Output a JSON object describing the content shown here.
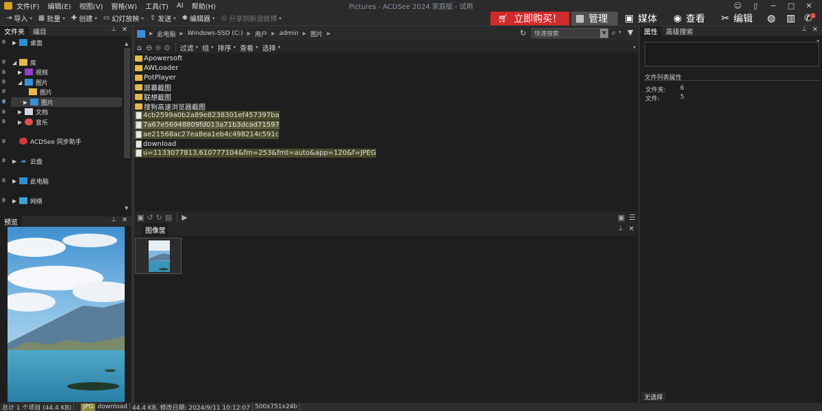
{
  "menu": [
    "文件(F)",
    "编辑(E)",
    "视图(V)",
    "窗格(W)",
    "工具(T)",
    "AI",
    "帮助(H)"
  ],
  "window_title": "Pictures - ACDSee 2024 家庭版 - 试用",
  "toolbar": {
    "import": "导入",
    "batch": "批量",
    "create": "创建",
    "slideshow": "幻灯放映",
    "send": "发送",
    "editor": "编辑器",
    "share": "分享到新浪微博"
  },
  "buy": "立即购买！",
  "modes": {
    "manage": "管理",
    "media": "媒体",
    "view": "查看",
    "edit": "编辑"
  },
  "left_tabs": {
    "folders": "文件夹",
    "edit": "编目"
  },
  "tree": {
    "desktop": "桌面",
    "library": "库",
    "video": "视频",
    "pictures": "图片",
    "pictures_sub1": "图片",
    "pictures_sub2": "图片",
    "docs": "文档",
    "music": "音乐",
    "acdsee": "ACDSee 同步助手",
    "cloud": "云盘",
    "pc": "此电脑",
    "network": "网络"
  },
  "preview_tab": "预览",
  "address": {
    "crumbs": [
      "此电脑",
      "Windows-SSD (C:)",
      "用户",
      "admin",
      "图片"
    ],
    "search_placeholder": "快速搜索"
  },
  "subbar": {
    "filter": "过滤",
    "group": "组",
    "sort": "排序",
    "view": "查看",
    "select": "选择"
  },
  "files": [
    {
      "name": "Apowersoft",
      "kind": "folder"
    },
    {
      "name": "AWLoader",
      "kind": "folder"
    },
    {
      "name": "PotPlayer",
      "kind": "folder"
    },
    {
      "name": "屏幕截图",
      "kind": "folder"
    },
    {
      "name": "联想截图",
      "kind": "folder"
    },
    {
      "name": "搜狗高速浏览器截图",
      "kind": "folder"
    },
    {
      "name": "4cb2599a0b2a89e8238301ef457397ba",
      "kind": "image"
    },
    {
      "name": "7a67e56948809fd013a71b3dcad71597",
      "kind": "image"
    },
    {
      "name": "ae21568ac27ea8ea1eb4c498214c591c",
      "kind": "image"
    },
    {
      "name": "download",
      "kind": "image"
    },
    {
      "name": "u=1133077813,610777104&fm=253&fmt=auto&app=120&f=JPEG",
      "kind": "image"
    }
  ],
  "basket_tab": "图像筐",
  "props": {
    "tab_props": "属性",
    "tab_search": "高级搜索",
    "section": "文件列表属性",
    "folders_label": "文件夹:",
    "folders_value": "6",
    "files_label": "文件:",
    "files_value": "5",
    "bottom_tab": "无选择"
  },
  "status": {
    "total": "总计 1 个项目 (44.4 KB)",
    "format": "JPG",
    "name": "download",
    "info": "44.4 KB, 修改日期: 2024/9/11 10:12:07",
    "dims": "500x751x24b"
  },
  "colors": {
    "buy": "#d02b2b",
    "folder": "#e6b84a",
    "highlight": "#4a4a2a",
    "title": "#8a93a3"
  }
}
